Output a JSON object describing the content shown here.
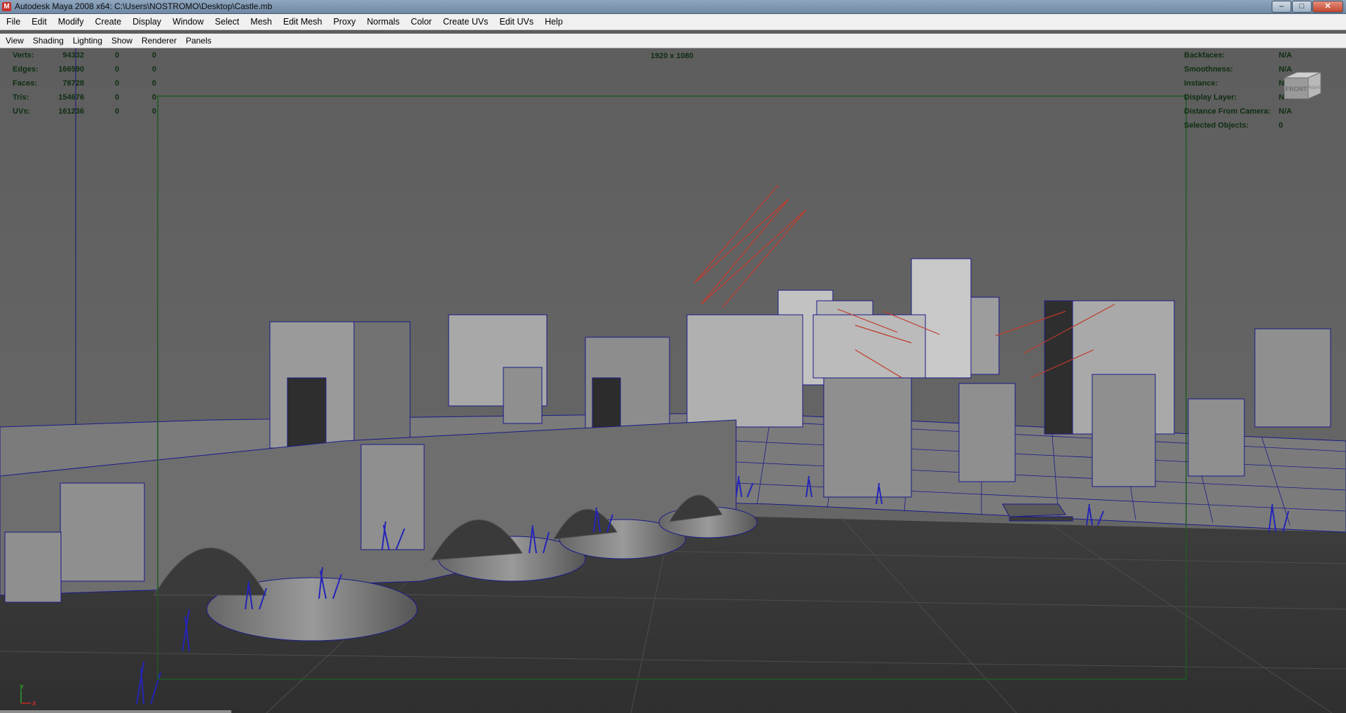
{
  "window": {
    "title": "Autodesk Maya 2008 x64: C:\\Users\\NOSTROMO\\Desktop\\Castle.mb",
    "buttons": {
      "minimize": "–",
      "maximize": "□",
      "close": "✕"
    }
  },
  "menubar": [
    "File",
    "Edit",
    "Modify",
    "Create",
    "Display",
    "Window",
    "Select",
    "Mesh",
    "Edit Mesh",
    "Proxy",
    "Normals",
    "Color",
    "Create UVs",
    "Edit UVs",
    "Help"
  ],
  "panel_menu": [
    "View",
    "Shading",
    "Lighting",
    "Show",
    "Renderer",
    "Panels"
  ],
  "hud": {
    "stats": [
      {
        "label": "Verts:",
        "v1": "94332",
        "v2": "0",
        "v3": "0"
      },
      {
        "label": "Edges:",
        "v1": "166590",
        "v2": "0",
        "v3": "0"
      },
      {
        "label": "Faces:",
        "v1": "78728",
        "v2": "0",
        "v3": "0"
      },
      {
        "label": "Tris:",
        "v1": "154676",
        "v2": "0",
        "v3": "0"
      },
      {
        "label": "UVs:",
        "v1": "161236",
        "v2": "0",
        "v3": "0"
      }
    ],
    "resolution": "1920 x 1080",
    "object_info": [
      {
        "label": "Backfaces:",
        "value": "N/A"
      },
      {
        "label": "Smoothness:",
        "value": "N/A"
      },
      {
        "label": "Instance:",
        "value": "N/A"
      },
      {
        "label": "Display Layer:",
        "value": "N/A"
      },
      {
        "label": "Distance From Camera:",
        "value": "N/A"
      },
      {
        "label": "Selected Objects:",
        "value": "0"
      }
    ],
    "viewcube": {
      "front": "FRONT",
      "right": "RIGHT"
    },
    "axis": {
      "y": "y",
      "x": "x"
    },
    "color": "#0e2d10"
  },
  "colors": {
    "wire": "#1a1a8a",
    "light_arrows": "#c0392b",
    "resolution_gate": "#1e5a24",
    "ground": "#3a3a3a"
  }
}
